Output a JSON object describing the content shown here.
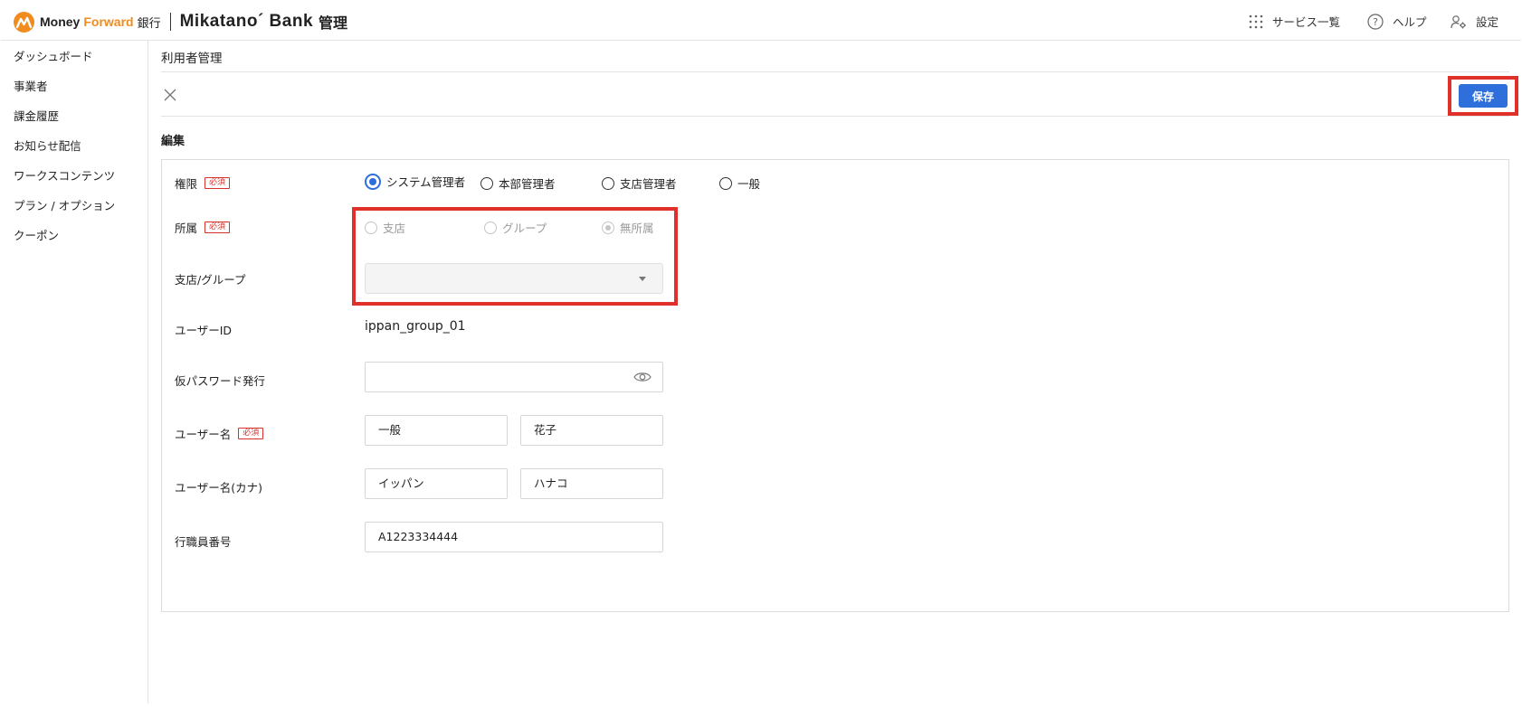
{
  "header": {
    "logo_money": "Money",
    "logo_forward": "Forward",
    "logo_ginko": "銀行",
    "logo_product": "Mikatano´ Bank",
    "logo_kanri": "管理",
    "services_label": "サービス一覧",
    "help_label": "ヘルプ",
    "settings_label": "設定"
  },
  "sidebar": {
    "items": [
      {
        "label": "ダッシュボード"
      },
      {
        "label": "事業者"
      },
      {
        "label": "課金履歴"
      },
      {
        "label": "お知らせ配信"
      },
      {
        "label": "ワークスコンテンツ"
      },
      {
        "label": "プラン / オプション"
      },
      {
        "label": "クーポン"
      }
    ]
  },
  "main": {
    "page_title": "利用者管理",
    "save_label": "保存",
    "section_title": "編集"
  },
  "form": {
    "required_badge": "必須",
    "role": {
      "label": "権限",
      "options": [
        "システム管理者",
        "本部管理者",
        "支店管理者",
        "一般"
      ],
      "selected": "システム管理者"
    },
    "affiliation": {
      "label": "所属",
      "options": [
        "支店",
        "グループ",
        "無所属"
      ],
      "selected": "無所属",
      "disabled": true
    },
    "branch_group": {
      "label": "支店/グループ",
      "value": ""
    },
    "user_id": {
      "label": "ユーザーID",
      "value": "ippan_group_01"
    },
    "temp_password": {
      "label": "仮パスワード発行",
      "value": ""
    },
    "user_name": {
      "label": "ユーザー名",
      "last": "一般",
      "first": "花子"
    },
    "user_name_kana": {
      "label": "ユーザー名(カナ)",
      "last": "イッパン",
      "first": "ハナコ"
    },
    "staff_number": {
      "label": "行職員番号",
      "value": "A1223334444"
    }
  },
  "colors": {
    "accent": "#2e6fdc",
    "brand_orange": "#f08c1e",
    "highlight_red": "#e0302a",
    "required_red": "#d6322b"
  }
}
